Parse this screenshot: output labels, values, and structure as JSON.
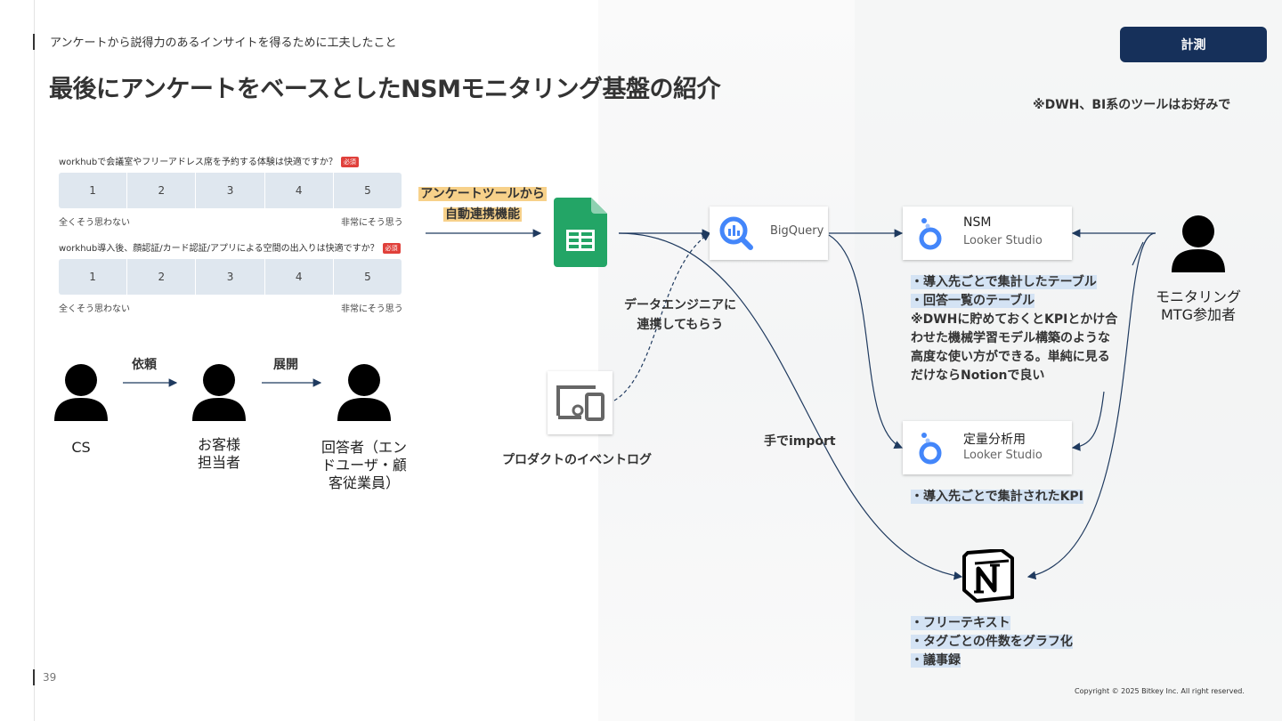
{
  "header": {
    "subtitle": "アンケートから説得力のあるインサイトを得るために工夫したこと",
    "title": "最後にアンケートをベースとしたNSMモニタリング基盤の紹介",
    "tag": "計測",
    "note": "※DWH、BI系のツールはお好みで"
  },
  "survey": {
    "q1": "workhubで会議室やフリーアドレス席を予約する体験は快適ですか？",
    "q2": "workhub導入後、顔認証/カード認証/アプリによる空間の出入りは快適ですか？",
    "required": "必須",
    "scale": [
      "1",
      "2",
      "3",
      "4",
      "5"
    ],
    "low_label": "全くそう思わない",
    "high_label": "非常にそう思う"
  },
  "people": {
    "cs": "CS",
    "arrow1": "依頼",
    "customer_line1": "お客様",
    "customer_line2": "担当者",
    "arrow2": "展開",
    "resp_line1": "回答者（エン",
    "resp_line2": "ドユーザ・顧",
    "resp_line3": "客従業員）"
  },
  "flow": {
    "tool_line1": "アンケートツールから",
    "tool_line2": "自動連携機能",
    "eng_line1": "データエンジニアに",
    "eng_line2": "連携してもらう",
    "event_log": "プロダクトのイベントログ",
    "manual": "手でimport",
    "bigquery": "BigQuery"
  },
  "looker_nsm": {
    "title": "NSM",
    "sub": "Looker Studio"
  },
  "looker_analysis": {
    "title": "定量分析用",
    "sub": "Looker Studio"
  },
  "nsm_notes": {
    "b1": "・導入先ごとで集計したテーブル",
    "b2": "・回答一覧のテーブル",
    "n1": "※DWHに貯めておくとKPIとかけ合",
    "n2": "わせた機械学習モデル構築のような",
    "n3": "高度な使い方ができる。単純に見る",
    "n4": "だけならNotionで良い"
  },
  "analysis_notes": {
    "b1": "・導入先ごとで集計されたKPI"
  },
  "notion_notes": {
    "b1": "・フリーテキスト",
    "b2": "・タグごとの件数をグラフ化",
    "b3": "・議事録"
  },
  "monitor": {
    "line1": "モニタリング",
    "line2": "MTG参加者"
  },
  "footer": {
    "page": "39",
    "copyright": "Copyright © 2025 Bitkey Inc. All right reserved."
  }
}
